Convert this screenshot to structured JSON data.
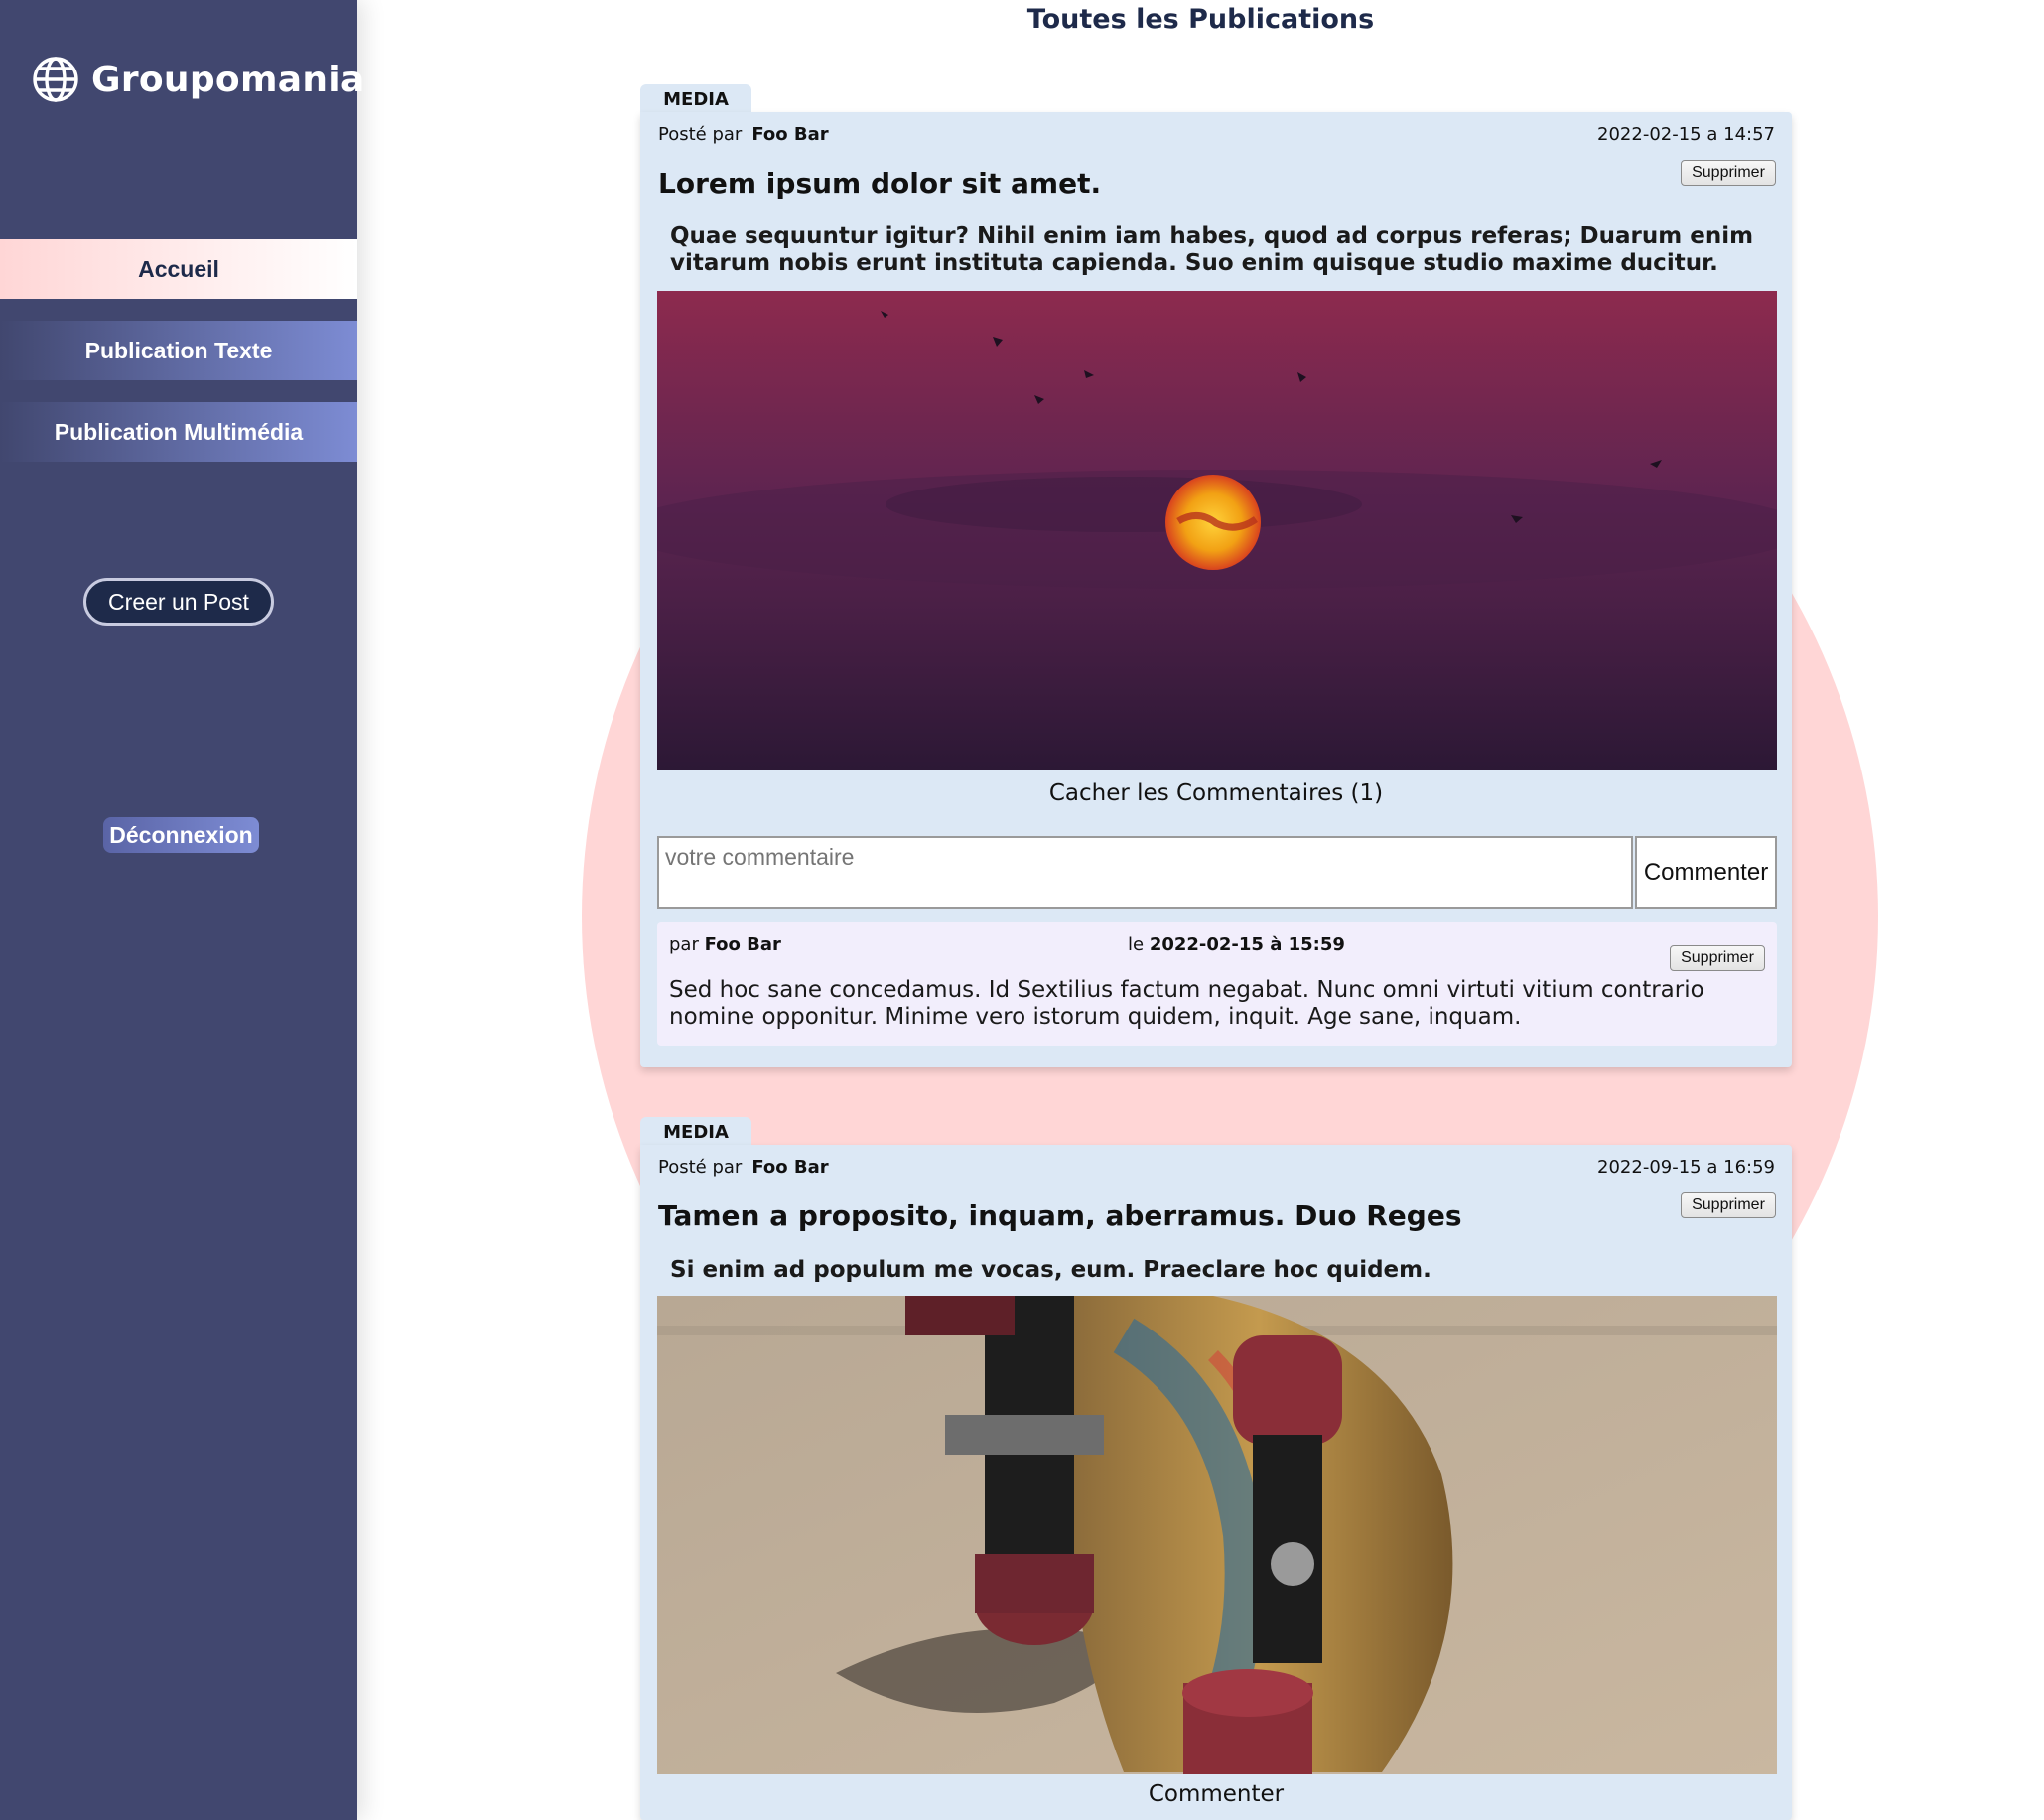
{
  "app": {
    "brand": "Groupomania"
  },
  "sidebar": {
    "items": [
      {
        "label": "Accueil"
      },
      {
        "label": "Publication Texte"
      },
      {
        "label": "Publication Multimédia"
      }
    ],
    "create_post_label": "Creer un Post",
    "logout_label": "Déconnexion"
  },
  "main": {
    "title": "Toutes les Publications",
    "posts": [
      {
        "type_label": "MEDIA",
        "posted_by_label": "Posté par",
        "author": "Foo Bar",
        "date": "2022-02-15 a 14:57",
        "delete_label": "Supprimer",
        "title": "Lorem ipsum dolor sit amet.",
        "body": "Quae sequuntur igitur? Nihil enim iam habes, quod ad corpus referas; Duarum enim vitarum nobis erunt instituta capienda. Suo enim quisque studio maxime ducitur.",
        "toggle_comments_label": "Cacher les Commentaires (1)",
        "comment_placeholder": "votre commentaire",
        "comment_submit_label": "Commenter",
        "comments": [
          {
            "by_label": "par",
            "author": "Foo Bar",
            "date_prefix": "le",
            "date": "2022-02-15 à 15:59",
            "delete_label": "Supprimer",
            "text": "Sed hoc sane concedamus. Id Sextilius factum negabat. Nunc omni virtuti vitium contrario nomine opponitur. Minime vero istorum quidem, inquit. Age sane, inquam."
          }
        ]
      },
      {
        "type_label": "MEDIA",
        "posted_by_label": "Posté par",
        "author": "Foo Bar",
        "date": "2022-09-15 a 16:59",
        "delete_label": "Supprimer",
        "title": "Tamen a proposito, inquam, aberramus. Duo Reges",
        "body": "Si enim ad populum me vocas, eum. Praeclare hoc quidem.",
        "comment_link_label": "Commenter"
      }
    ]
  },
  "colors": {
    "sidebar_bg": "#41476f",
    "accent_pink": "#ffd6d6",
    "card_bg": "#dce8f5",
    "comment_bg": "#f2eefc",
    "title_navy": "#1e2a4a"
  }
}
